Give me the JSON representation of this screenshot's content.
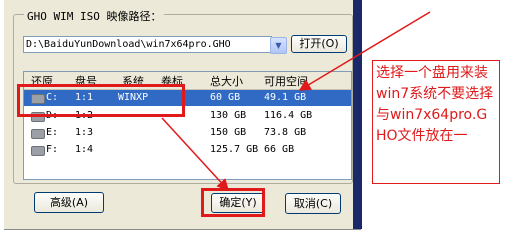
{
  "group": {
    "title": "GHO WIM ISO 映像路径："
  },
  "path": {
    "value": "D:\\BaiduYunDownload\\win7x64pro.GHO"
  },
  "open_button": {
    "label": "打开(O)"
  },
  "columns": [
    "还原",
    "盘号",
    "系统",
    "卷标",
    "总大小",
    "可用空间"
  ],
  "partitions": [
    {
      "drive": "C:",
      "num": "1:1",
      "system": "WINXP",
      "label": "",
      "total": "60 GB",
      "free": "49.1 GB",
      "selected": true
    },
    {
      "drive": "D:",
      "num": "1:2",
      "system": "",
      "label": "",
      "total": "130 GB",
      "free": "116.4 GB",
      "selected": false
    },
    {
      "drive": "E:",
      "num": "1:3",
      "system": "",
      "label": "",
      "total": "150 GB",
      "free": "73.8 GB",
      "selected": false
    },
    {
      "drive": "F:",
      "num": "1:4",
      "system": "",
      "label": "",
      "total": "125.7 GB",
      "free": "66 GB",
      "selected": false
    }
  ],
  "buttons": {
    "advanced": "高级(A)",
    "ok": "确定(Y)",
    "cancel": "取消(C)"
  },
  "annotation": {
    "text": "选择一个盘用来装win7系统不要选择与win7x64pro.GHO文件放在一"
  },
  "colors": {
    "highlight": "#e01a1a",
    "selection": "#316ac5"
  }
}
